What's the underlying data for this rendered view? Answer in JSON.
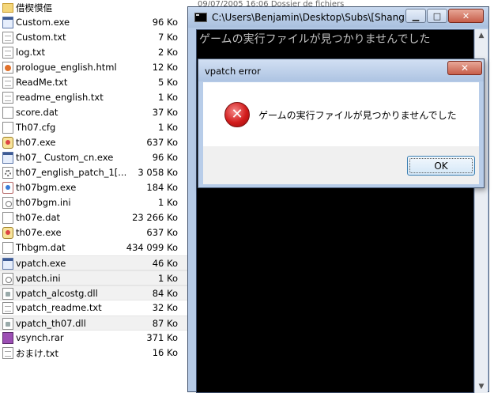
{
  "explorer": {
    "partial_header": "09/07/2005 16:06      Dossier de fichiers",
    "files": [
      {
        "name": "借楔慔傴",
        "size": "",
        "icon": "folder",
        "selected": false
      },
      {
        "name": "Custom.exe",
        "size": "96 Ko",
        "icon": "exe",
        "selected": false
      },
      {
        "name": "Custom.txt",
        "size": "7 Ko",
        "icon": "txt",
        "selected": false
      },
      {
        "name": "log.txt",
        "size": "2 Ko",
        "icon": "txt",
        "selected": false
      },
      {
        "name": "prologue_english.html",
        "size": "12 Ko",
        "icon": "html",
        "selected": false
      },
      {
        "name": "ReadMe.txt",
        "size": "5 Ko",
        "icon": "txt",
        "selected": false
      },
      {
        "name": "readme_english.txt",
        "size": "1 Ko",
        "icon": "txt",
        "selected": false
      },
      {
        "name": "score.dat",
        "size": "37 Ko",
        "icon": "dat",
        "selected": false
      },
      {
        "name": "Th07.cfg",
        "size": "1 Ko",
        "icon": "dat",
        "selected": false
      },
      {
        "name": "th07.exe",
        "size": "637 Ko",
        "icon": "thexe",
        "selected": false
      },
      {
        "name": "th07_ Custom_cn.exe",
        "size": "96 Ko",
        "icon": "exe",
        "selected": false
      },
      {
        "name": "th07_english_patch_1[...",
        "size": "3 058 Ko",
        "icon": "gear",
        "selected": false
      },
      {
        "name": "th07bgm.exe",
        "size": "184 Ko",
        "icon": "bgm",
        "selected": false
      },
      {
        "name": "th07bgm.ini",
        "size": "1 Ko",
        "icon": "ini",
        "selected": false
      },
      {
        "name": "th07e.dat",
        "size": "23 266 Ko",
        "icon": "dat",
        "selected": false
      },
      {
        "name": "th07e.exe",
        "size": "637 Ko",
        "icon": "thexe",
        "selected": false
      },
      {
        "name": "Thbgm.dat",
        "size": "434 099 Ko",
        "icon": "dat",
        "selected": false
      },
      {
        "name": "vpatch.exe",
        "size": "46 Ko",
        "icon": "exe",
        "selected": true
      },
      {
        "name": "vpatch.ini",
        "size": "1 Ko",
        "icon": "ini",
        "selected": true
      },
      {
        "name": "vpatch_alcostg.dll",
        "size": "84 Ko",
        "icon": "dll",
        "selected": true
      },
      {
        "name": "vpatch_readme.txt",
        "size": "32 Ko",
        "icon": "txt",
        "selected": false
      },
      {
        "name": "vpatch_th07.dll",
        "size": "87 Ko",
        "icon": "dll",
        "selected": true
      },
      {
        "name": "vsynch.rar",
        "size": "371 Ko",
        "icon": "rar",
        "selected": false
      },
      {
        "name": "おまけ.txt",
        "size": "16 Ko",
        "icon": "txt",
        "selected": false
      }
    ]
  },
  "console": {
    "title": "C:\\Users\\Benjamin\\Desktop\\Subs\\[Shanghai",
    "output": "ゲームの実行ファイルが見つかりませんでした",
    "minimize_glyph": "▁",
    "maximize_glyph": "□",
    "close_glyph": "✕",
    "scroll_up_glyph": "▲",
    "scroll_down_glyph": "▼"
  },
  "dialog": {
    "title": "vpatch error",
    "close_glyph": "✕",
    "icon_glyph": "✕",
    "message": "ゲームの実行ファイルが見つかりませんでした",
    "ok_label": "OK"
  },
  "colors": {
    "error_icon": "#d21c1c",
    "window_frame": "#b5cae6",
    "console_background": "#000000",
    "console_text": "#c0c0c0",
    "selection": "#f1f1f1"
  }
}
